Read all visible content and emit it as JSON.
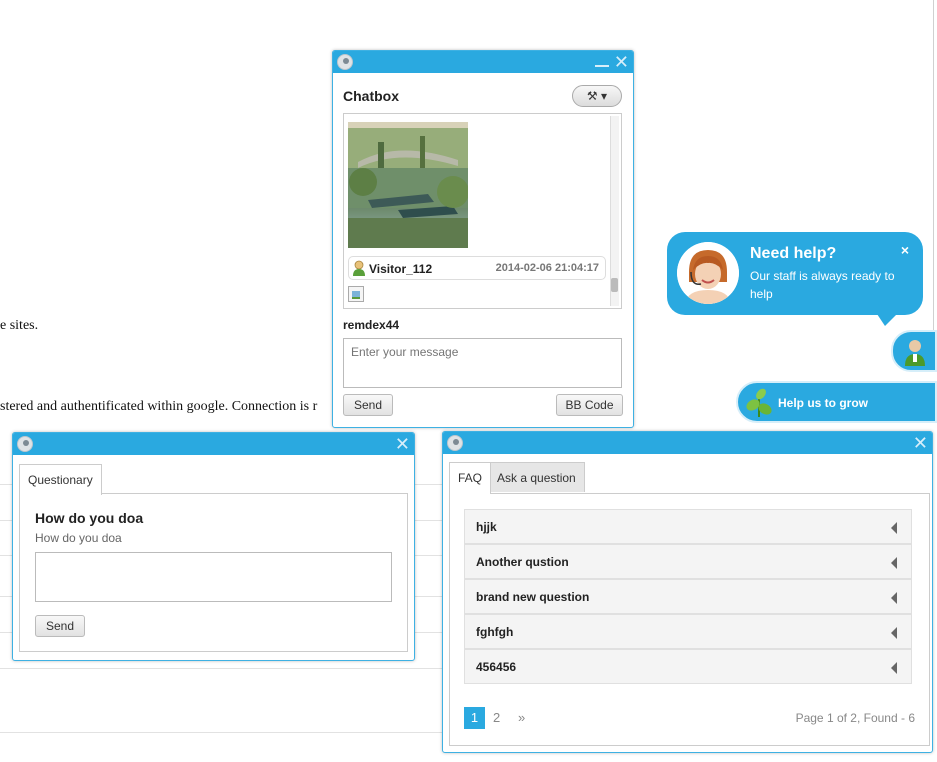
{
  "background": {
    "line1": "e sites.",
    "line2": "stered and authentificated within google. Connection is r"
  },
  "chatbox": {
    "title": "Chatbox",
    "tools_icon": "tools-icon",
    "message": {
      "author": "Visitor_112",
      "time": "2014-02-06 21:04:17"
    },
    "username": "remdex44",
    "input_placeholder": "Enter your message",
    "send_label": "Send",
    "bbcode_label": "BB Code"
  },
  "need_help": {
    "title": "Need help?",
    "text": "Our staff is always ready to help",
    "close": "×"
  },
  "grow": {
    "label": "Help us to grow"
  },
  "questionary": {
    "tab": "Questionary",
    "title": "How do you doa",
    "subtitle": "How do you doa",
    "send_label": "Send"
  },
  "faq": {
    "tabs": [
      "FAQ",
      "Ask a question"
    ],
    "items": [
      "hjjk",
      "Another qustion",
      "brand new question",
      "fghfgh",
      "456456"
    ],
    "pagination": {
      "pages": [
        "1",
        "2"
      ],
      "next": "»",
      "info": "Page 1 of 2, Found - 6"
    }
  },
  "colors": {
    "accent": "#2aa9e0"
  }
}
